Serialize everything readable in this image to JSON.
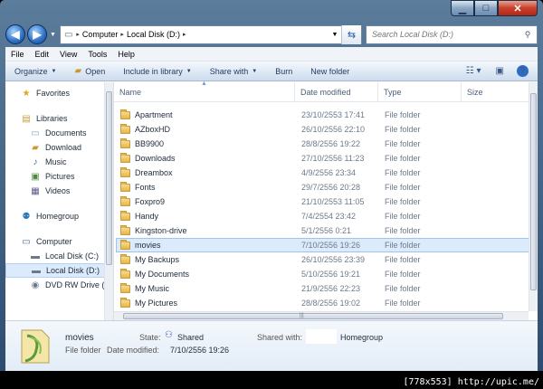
{
  "caption": {
    "min": "▁",
    "max": "□",
    "close": "✕"
  },
  "address": {
    "back_icon": "◀",
    "forward_icon": "▶",
    "crumbs": [
      "Computer",
      "Local Disk (D:)"
    ],
    "search_placeholder": "Search Local Disk (D:)"
  },
  "menu": [
    "File",
    "Edit",
    "View",
    "Tools",
    "Help"
  ],
  "toolbar": {
    "organize": "Organize",
    "open": "Open",
    "include": "Include in library",
    "share": "Share with",
    "burn": "Burn",
    "new_folder": "New folder",
    "help": "?"
  },
  "nav": {
    "favorites": "Favorites",
    "libraries": "Libraries",
    "documents": "Documents",
    "download": "Download",
    "music": "Music",
    "pictures": "Pictures",
    "videos": "Videos",
    "homegroup": "Homegroup",
    "computer": "Computer",
    "disk_c": "Local Disk (C:)",
    "disk_d": "Local Disk (D:)",
    "dvd": "DVD RW Drive (E"
  },
  "columns": {
    "name": "Name",
    "date": "Date modified",
    "type": "Type",
    "size": "Size"
  },
  "files": [
    {
      "name": "Apartment",
      "date": "23/10/2553 17:41",
      "type": "File folder"
    },
    {
      "name": "AZboxHD",
      "date": "26/10/2556 22:10",
      "type": "File folder"
    },
    {
      "name": "BB9900",
      "date": "28/8/2556 19:22",
      "type": "File folder"
    },
    {
      "name": "Downloads",
      "date": "27/10/2556 11:23",
      "type": "File folder"
    },
    {
      "name": "Dreambox",
      "date": "4/9/2556 23:34",
      "type": "File folder"
    },
    {
      "name": "Fonts",
      "date": "29/7/2556 20:28",
      "type": "File folder"
    },
    {
      "name": "Foxpro9",
      "date": "21/10/2553 11:05",
      "type": "File folder"
    },
    {
      "name": "Handy",
      "date": "7/4/2554 23:42",
      "type": "File folder"
    },
    {
      "name": "Kingston-drive",
      "date": "5/1/2556 0:21",
      "type": "File folder"
    },
    {
      "name": "movies",
      "date": "7/10/2556 19:26",
      "type": "File folder",
      "selected": true
    },
    {
      "name": "My Backups",
      "date": "26/10/2556 23:39",
      "type": "File folder"
    },
    {
      "name": "My Documents",
      "date": "5/10/2556 19:21",
      "type": "File folder"
    },
    {
      "name": "My Music",
      "date": "21/9/2556 22:23",
      "type": "File folder"
    },
    {
      "name": "My Pictures",
      "date": "28/8/2556 19:02",
      "type": "File folder"
    }
  ],
  "details": {
    "name": "movies",
    "kind": "File folder",
    "modified_label": "Date modified:",
    "modified_value": "7/10/2556 19:26",
    "state_label": "State:",
    "state_value": "Shared",
    "shared_label": "Shared with:",
    "shared_value": "Homegroup"
  },
  "watermark": "[778x553] http://upic.me/"
}
